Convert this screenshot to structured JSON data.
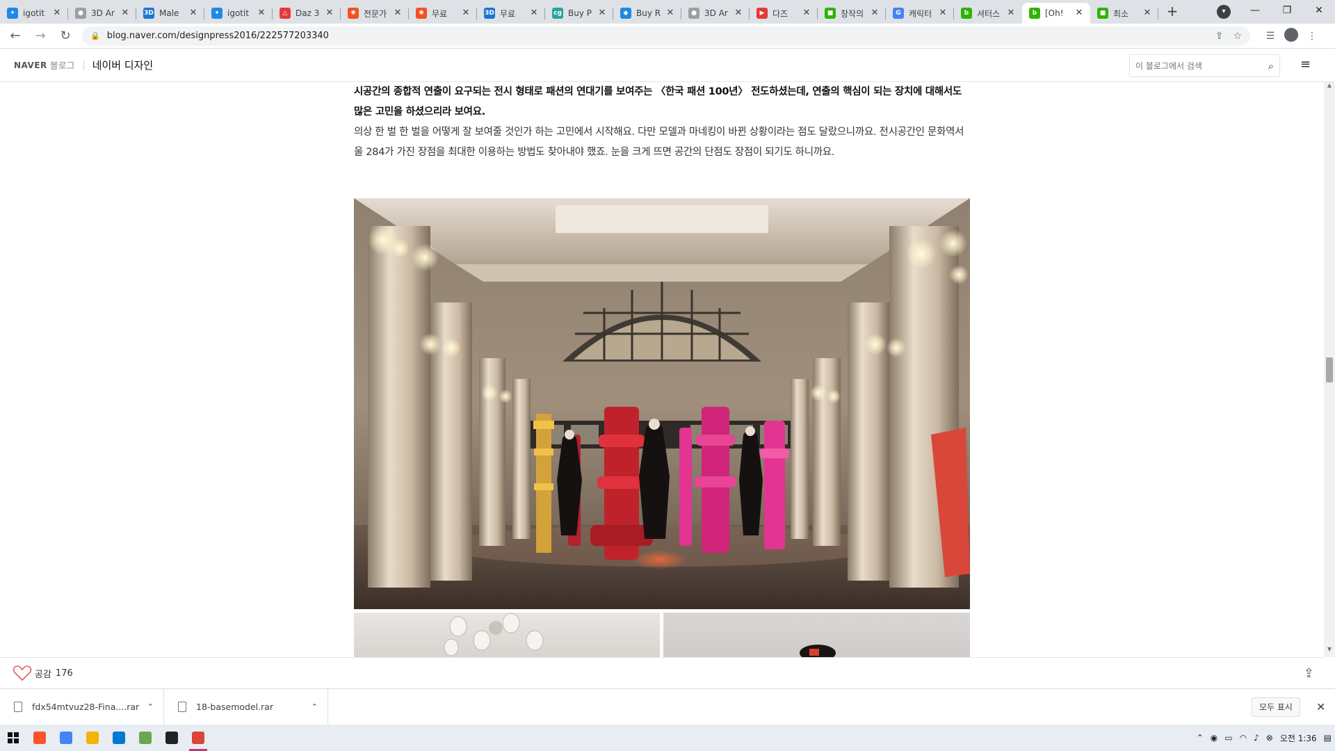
{
  "browser": {
    "tabs": [
      {
        "title": "igotit",
        "color": "#1e88e5",
        "glyph": "✦"
      },
      {
        "title": "3D Ar",
        "color": "#9e9e9e",
        "glyph": "●"
      },
      {
        "title": "Male",
        "color": "#1976d2",
        "glyph": "3D"
      },
      {
        "title": "igotit",
        "color": "#1e88e5",
        "glyph": "✦"
      },
      {
        "title": "Daz 3",
        "color": "#e53935",
        "glyph": "△"
      },
      {
        "title": "전문가",
        "color": "#f4511e",
        "glyph": "✺"
      },
      {
        "title": "무료",
        "color": "#f4511e",
        "glyph": "✺"
      },
      {
        "title": "무료",
        "color": "#1976d2",
        "glyph": "3D"
      },
      {
        "title": "Buy P",
        "color": "#26a69a",
        "glyph": "cg"
      },
      {
        "title": "Buy R",
        "color": "#1e88e5",
        "glyph": "◆"
      },
      {
        "title": "3D Ar",
        "color": "#9e9e9e",
        "glyph": "●"
      },
      {
        "title": "다즈",
        "color": "#e53935",
        "glyph": "▶"
      },
      {
        "title": "창작의",
        "color": "#2db400",
        "glyph": "■"
      },
      {
        "title": "캐릭터",
        "color": "#4285f4",
        "glyph": "G"
      },
      {
        "title": "셔터스",
        "color": "#2db400",
        "glyph": "b"
      },
      {
        "title": "[Oh!",
        "color": "#2db400",
        "glyph": "b"
      },
      {
        "title": "최소",
        "color": "#2db400",
        "glyph": "■"
      }
    ],
    "active_tab_index": 15,
    "url": "blog.naver.com/designpress2016/222577203340"
  },
  "naver": {
    "logo": "NAVER",
    "blog_label": "블로그",
    "blog_name": "네이버 디자인",
    "search_placeholder": "이 블로그에서 검색"
  },
  "article": {
    "bold_paragraph": "시공간의 종합적 연출이 요구되는 전시 형태로 패션의 연대기를 보여주는 〈한국 패션 100년〉 전도하셨는데, 연출의 핵심이 되는 장치에 대해서도 많은 고민을 하셨으리라 보여요.",
    "paragraph": "의상 한 벌 한 벌을 어떻게 잘 보여줄 것인가 하는 고민에서 시작해요. 다만 모델과 마네킹이 바뀐 상황이라는 점도 달랐으니까요. 전시공간인 문화역서울 284가 가진 장점을 최대한 이용하는 방법도 찾아내야 했죠. 눈을 크게 뜨면 공간의 단점도 장점이 되기도 하니까요."
  },
  "likebar": {
    "label": "공감",
    "count": "176"
  },
  "downloads": {
    "items": [
      {
        "name": "fdx54mtvuz28-Fina....rar"
      },
      {
        "name": "18-basemodel.rar"
      }
    ],
    "show_all": "모두 표시"
  },
  "taskbar": {
    "apps": [
      {
        "name": "brave",
        "color": "#fb542b"
      },
      {
        "name": "chrome",
        "color": "#4285f4"
      },
      {
        "name": "explorer",
        "color": "#f4b400"
      },
      {
        "name": "vscode",
        "color": "#0078d4"
      },
      {
        "name": "notepad",
        "color": "#6aa84f"
      },
      {
        "name": "terminal",
        "color": "#222222"
      },
      {
        "name": "chrome-active",
        "color": "#db4437"
      }
    ],
    "time": "오전 1:36"
  }
}
